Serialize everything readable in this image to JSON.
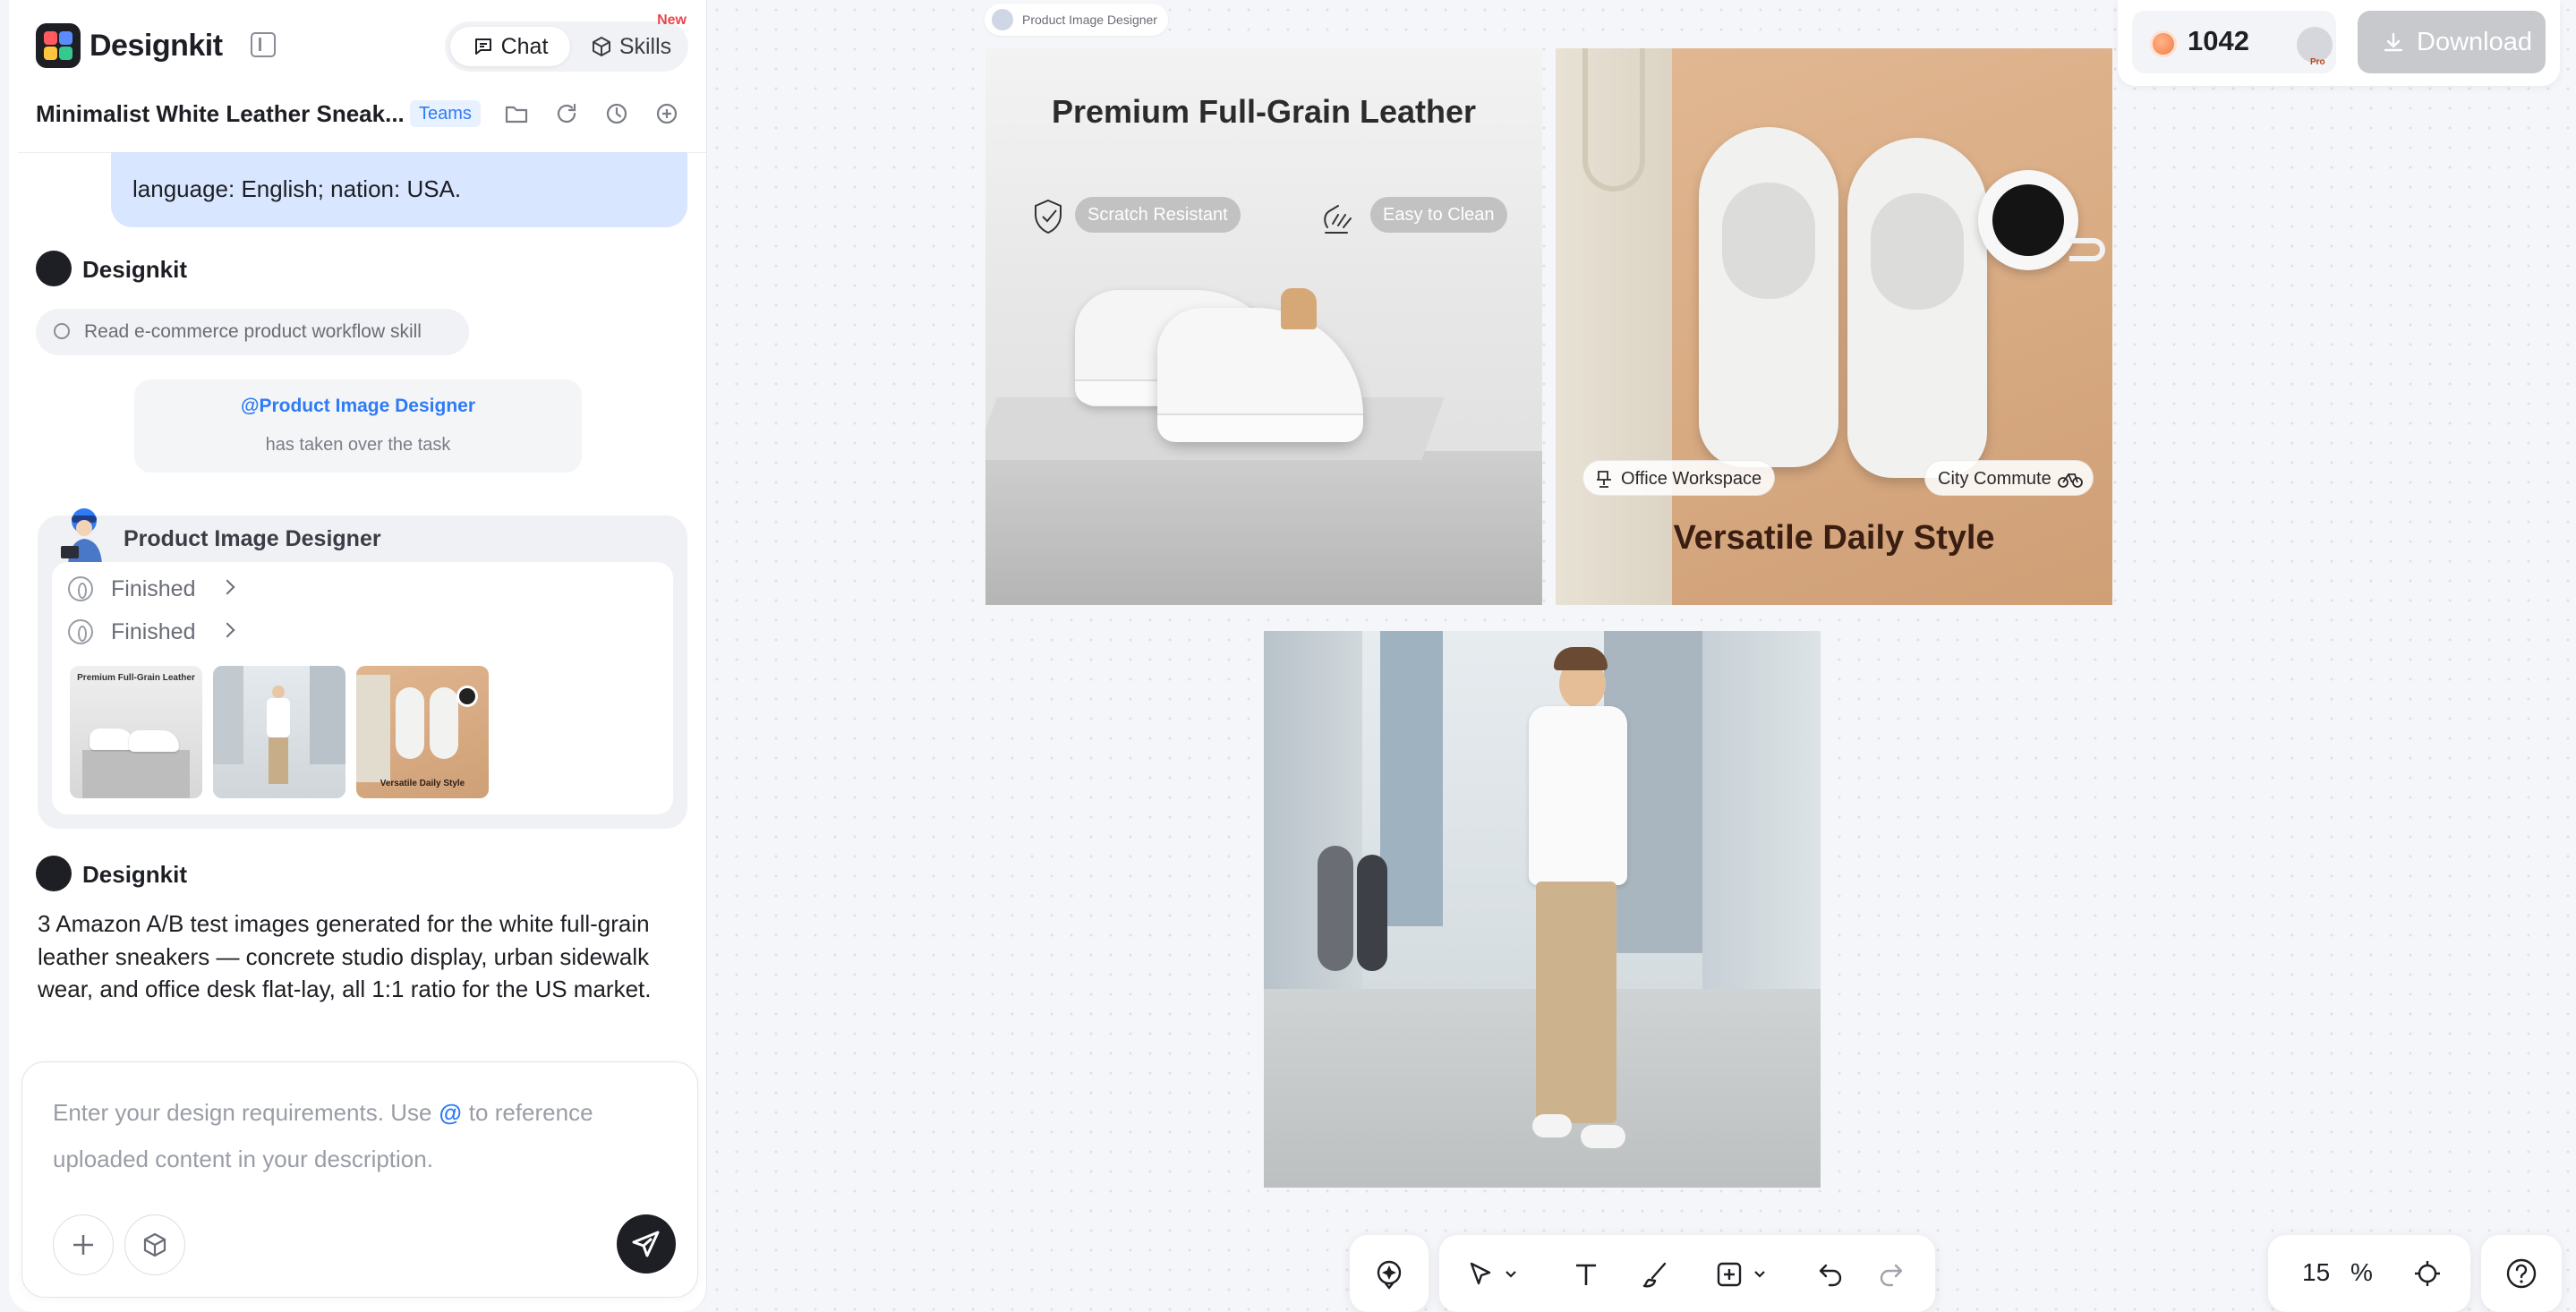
{
  "app": {
    "brand": "Designkit",
    "modes": {
      "chat": "Chat",
      "skills": "Skills",
      "new_badge": "New"
    },
    "project_title": "Minimalist White Leather Sneak...",
    "teams_tag": "Teams"
  },
  "chat": {
    "user_message_tail": "language: English; nation: USA.",
    "assistant_name": "Designkit",
    "tool_call": "Read e-commerce product workflow skill",
    "handoff": {
      "agent": "@Product Image Designer",
      "text": "has taken over the task"
    },
    "agent_card": {
      "name": "Product Image Designer",
      "steps": [
        "Finished",
        "Finished"
      ],
      "thumb_captions": [
        "Premium Full-Grain Leather",
        "Versatile Daily Style"
      ]
    },
    "summary": "3 Amazon A/B test images generated for the white full-grain leather sneakers — concrete studio display, urban sidewalk wear, and office desk flat-lay, all 1:1 ratio for the US market."
  },
  "composer": {
    "placeholder_before": "Enter your design requirements. Use",
    "placeholder_at": "@",
    "placeholder_after": "to reference uploaded content in your description."
  },
  "canvas": {
    "frame_label": "Product Image Designer",
    "image1": {
      "headline": "Premium Full-Grain Leather",
      "badge_left": "Scratch Resistant",
      "badge_right": "Easy to Clean"
    },
    "image2": {
      "headline": "Versatile Daily Style",
      "badge_left": "Office Workspace",
      "badge_right": "City Commute"
    }
  },
  "header_right": {
    "credits": "1042",
    "plan": "Pro",
    "download": "Download"
  },
  "zoom": {
    "value": "15",
    "unit": "%"
  },
  "colors": {
    "accent": "#2f7bf5",
    "user_bubble": "#d9e6ff",
    "dark": "#1d1f24",
    "alert": "#e5484d"
  },
  "icons": [
    "sidebar-collapse-icon",
    "chat-icon",
    "skills-cube-icon",
    "folder-icon",
    "refresh-icon",
    "history-icon",
    "add-circle-icon",
    "search-icon",
    "step-status-icon",
    "chevron-right-icon",
    "plus-icon",
    "cube-icon",
    "send-icon",
    "coin-icon",
    "user-avatar-icon",
    "download-icon",
    "ai-sparkle-icon",
    "cursor-icon",
    "chevron-down-icon",
    "text-icon",
    "brush-icon",
    "insert-icon",
    "undo-icon",
    "redo-icon",
    "fit-screen-icon",
    "help-icon"
  ]
}
